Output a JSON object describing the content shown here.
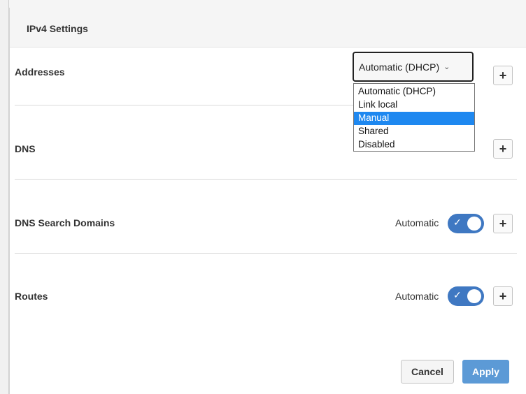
{
  "dialog": {
    "title": "IPv4 Settings",
    "cancel_label": "Cancel",
    "apply_label": "Apply"
  },
  "addresses": {
    "label": "Addresses",
    "selected": "Automatic (DHCP)",
    "options": [
      "Automatic (DHCP)",
      "Link local",
      "Manual",
      "Shared",
      "Disabled"
    ],
    "highlighted_option": "Manual",
    "add_label": "+"
  },
  "dns": {
    "label": "DNS",
    "add_label": "+"
  },
  "dns_search": {
    "label": "DNS Search Domains",
    "toggle_label": "Automatic",
    "toggle_on": true,
    "add_label": "+"
  },
  "routes": {
    "label": "Routes",
    "toggle_label": "Automatic",
    "toggle_on": true,
    "add_label": "+"
  },
  "icons": {
    "dropdown_chevron": "chevron-down-icon",
    "toggle_check": "check-icon",
    "add": "plus-icon"
  },
  "colors": {
    "toggle_on": "#3f78c2",
    "apply_button": "#5c9ad6",
    "option_highlight": "#1e88f0"
  }
}
